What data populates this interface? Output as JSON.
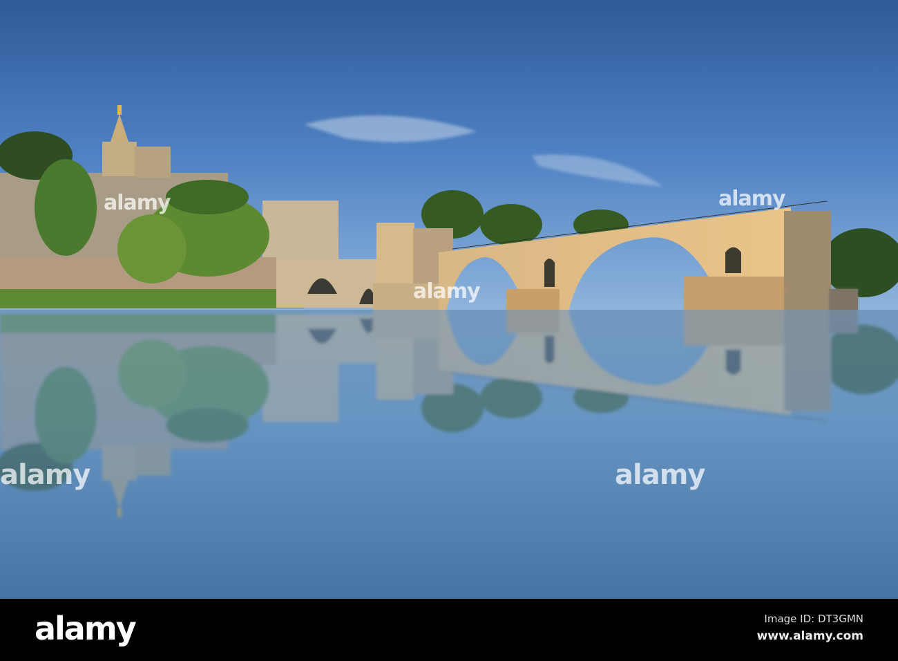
{
  "watermark": {
    "text": "alamy"
  },
  "footer": {
    "logo": "alamy",
    "image_id": "Image ID: DT3GMN",
    "website": "www.alamy.com"
  },
  "colors": {
    "sky_top": "#33609f",
    "sky_horizon": "#8fb4dc",
    "water": "#5d8cbb",
    "stone_lit": "#e2c08a",
    "foliage": "#4f7a2e"
  }
}
